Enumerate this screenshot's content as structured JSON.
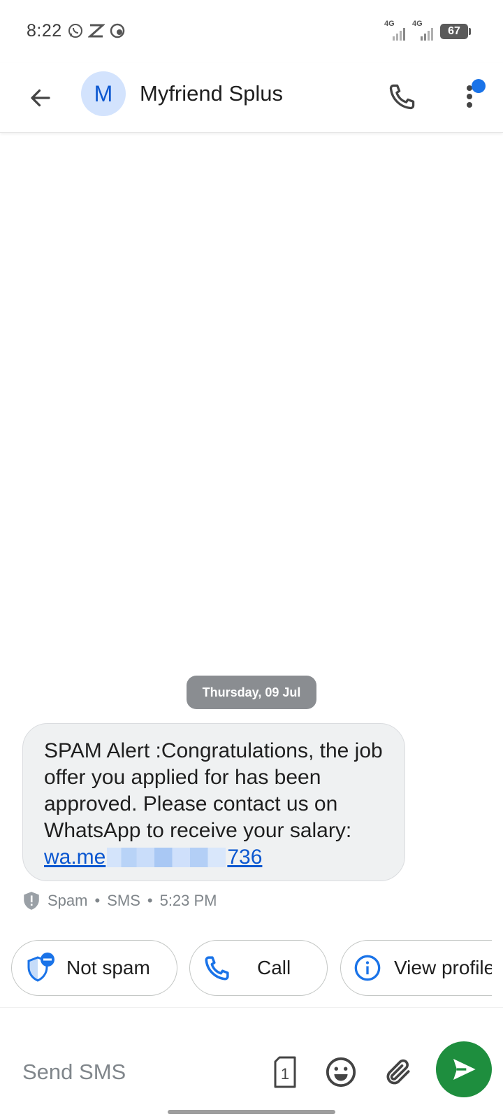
{
  "status_bar": {
    "time": "8:22",
    "left_icons": [
      "whatsapp-icon",
      "app-notification-icon",
      "vpn-icon"
    ],
    "signal_1_label": "4G",
    "signal_2_label": "4G",
    "battery_level": "67"
  },
  "header": {
    "avatar_letter": "M",
    "contact_name": "Myfriend Splus",
    "accent_color": "#1a73e8"
  },
  "conversation": {
    "date_chip": "Thursday, 09 Jul",
    "message": {
      "text": "SPAM Alert :Congratulations, the job offer you applied for has been approved. Please contact us on WhatsApp to receive your salary:",
      "link_prefix": "wa.me",
      "link_suffix": "736"
    },
    "meta": {
      "label": "Spam",
      "separator": "•",
      "type": "SMS",
      "time": "5:23 PM"
    }
  },
  "actions": {
    "not_spam": "Not spam",
    "call": "Call",
    "view_profile": "View profile"
  },
  "compose": {
    "placeholder": "Send SMS",
    "sim_label": "1",
    "send_color": "#1e8e3e"
  }
}
